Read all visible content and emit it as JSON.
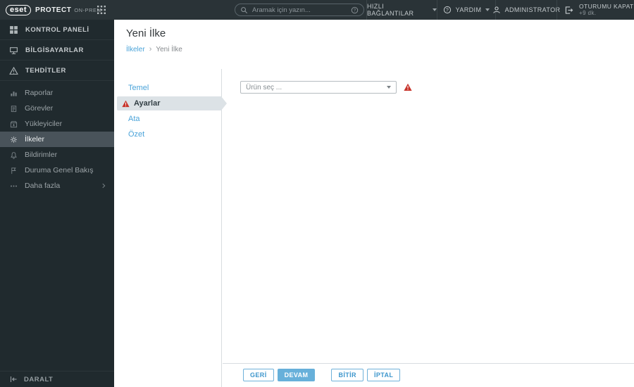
{
  "topbar": {
    "logo_text": "eset",
    "product_name": "PROTECT",
    "edition": "ON-PREM",
    "search_placeholder": "Aramak için yazın...",
    "quick_links_label": "HIZLI BAĞLANTILAR",
    "help_label": "YARDIM",
    "user_label": "ADMINISTRATOR",
    "logout_label": "OTURUMU KAPAT",
    "logout_timer": "+9 dk."
  },
  "sidebar": {
    "primary_items": [
      {
        "label": "KONTROL PANELİ"
      },
      {
        "label": "BİLGİSAYARLAR"
      },
      {
        "label": "TEHDİTLER"
      }
    ],
    "secondary_items": [
      {
        "label": "Raporlar"
      },
      {
        "label": "Görevler"
      },
      {
        "label": "Yükleyiciler"
      },
      {
        "label": "İlkeler"
      },
      {
        "label": "Bildirimler"
      },
      {
        "label": "Duruma Genel Bakış"
      },
      {
        "label": "Daha fazla"
      }
    ],
    "collapse_label": "DARALT"
  },
  "page": {
    "title": "Yeni İlke",
    "breadcrumb_parent": "İlkeler",
    "breadcrumb_separator": "›",
    "breadcrumb_current": "Yeni İlke"
  },
  "wizard_steps": [
    {
      "label": "Temel"
    },
    {
      "label": "Ayarlar",
      "state": "active-with-warning"
    },
    {
      "label": "Ata"
    },
    {
      "label": "Özet"
    }
  ],
  "content": {
    "product_select_value": "Ürün seç ..."
  },
  "footer_buttons": [
    {
      "label": "GERİ"
    },
    {
      "label": "DEVAM"
    },
    {
      "label": "BİTİR"
    },
    {
      "label": "İPTAL"
    }
  ],
  "colors": {
    "topbar_bg": "#2a3337",
    "sidebar_bg": "#202a2e",
    "sidebar_selected_bg": "#49535a",
    "accent_blue": "#4aa3d9",
    "button_text": "#3d96cc",
    "button_border": "#6fb1da",
    "button_fill": "#67b0da",
    "warning_red": "#c8342b",
    "active_step_bg": "#dce2e6",
    "divider": "#d8dde0"
  }
}
